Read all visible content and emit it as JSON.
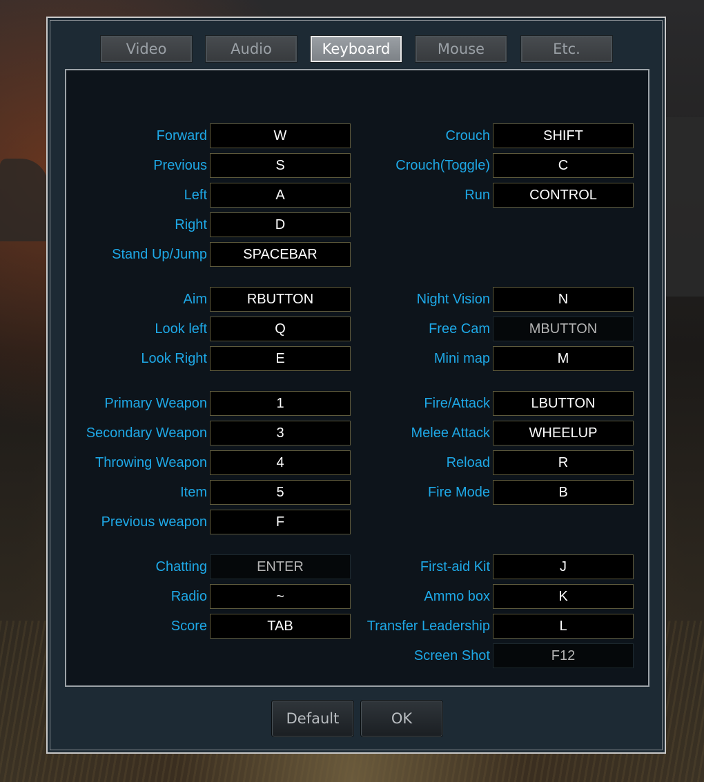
{
  "tabs": [
    {
      "label": "Video",
      "active": false
    },
    {
      "label": "Audio",
      "active": false
    },
    {
      "label": "Keyboard",
      "active": true
    },
    {
      "label": "Mouse",
      "active": false
    },
    {
      "label": "Etc.",
      "active": false
    }
  ],
  "bindings": {
    "left": [
      {
        "label": "Forward",
        "key": "W",
        "disabled": false
      },
      {
        "label": "Previous",
        "key": "S",
        "disabled": false
      },
      {
        "label": "Left",
        "key": "A",
        "disabled": false
      },
      {
        "label": "Right",
        "key": "D",
        "disabled": false
      },
      {
        "label": "Stand Up/Jump",
        "key": "SPACEBAR",
        "disabled": false
      },
      {
        "label": "Aim",
        "key": "RBUTTON",
        "disabled": false
      },
      {
        "label": "Look left",
        "key": "Q",
        "disabled": false
      },
      {
        "label": "Look Right",
        "key": "E",
        "disabled": false
      },
      {
        "label": "Primary Weapon",
        "key": "1",
        "disabled": false
      },
      {
        "label": "Secondary Weapon",
        "key": "3",
        "disabled": false
      },
      {
        "label": "Throwing Weapon",
        "key": "4",
        "disabled": false
      },
      {
        "label": "Item",
        "key": "5",
        "disabled": false
      },
      {
        "label": "Previous weapon",
        "key": "F",
        "disabled": false
      },
      {
        "label": "Chatting",
        "key": "ENTER",
        "disabled": true
      },
      {
        "label": "Radio",
        "key": "~",
        "disabled": false
      },
      {
        "label": "Score",
        "key": "TAB",
        "disabled": false
      }
    ],
    "right": [
      {
        "label": "Crouch",
        "key": "SHIFT",
        "disabled": false
      },
      {
        "label": "Crouch(Toggle)",
        "key": "C",
        "disabled": false
      },
      {
        "label": "Run",
        "key": "CONTROL",
        "disabled": false
      },
      {
        "label": "Night Vision",
        "key": "N",
        "disabled": false
      },
      {
        "label": "Free Cam",
        "key": "MBUTTON",
        "disabled": true
      },
      {
        "label": "Mini map",
        "key": "M",
        "disabled": false
      },
      {
        "label": "Fire/Attack",
        "key": "LBUTTON",
        "disabled": false
      },
      {
        "label": "Melee Attack",
        "key": "WHEELUP",
        "disabled": false
      },
      {
        "label": "Reload",
        "key": "R",
        "disabled": false
      },
      {
        "label": "Fire Mode",
        "key": "B",
        "disabled": false
      },
      {
        "label": "First-aid Kit",
        "key": "J",
        "disabled": false
      },
      {
        "label": "Ammo box",
        "key": "K",
        "disabled": false
      },
      {
        "label": "Transfer Leadership",
        "key": "L",
        "disabled": false
      },
      {
        "label": "Screen Shot",
        "key": "F12",
        "disabled": true
      }
    ]
  },
  "buttons": {
    "default_label": "Default",
    "ok_label": "OK"
  },
  "colors": {
    "label": "#1ea8e6",
    "key_text": "#ffffff",
    "panel_bg": "#0d141b"
  }
}
